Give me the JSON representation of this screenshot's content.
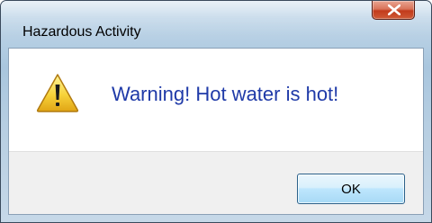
{
  "window": {
    "title": "Hazardous Activity"
  },
  "dialog": {
    "message": "Warning! Hot water is hot!",
    "icon": "warning-icon",
    "ok_label": "OK"
  },
  "colors": {
    "message_text": "#1f3aa8",
    "close_button": "#c23b1c",
    "frame": "#a9c6de",
    "footer": "#f0f0f0"
  }
}
